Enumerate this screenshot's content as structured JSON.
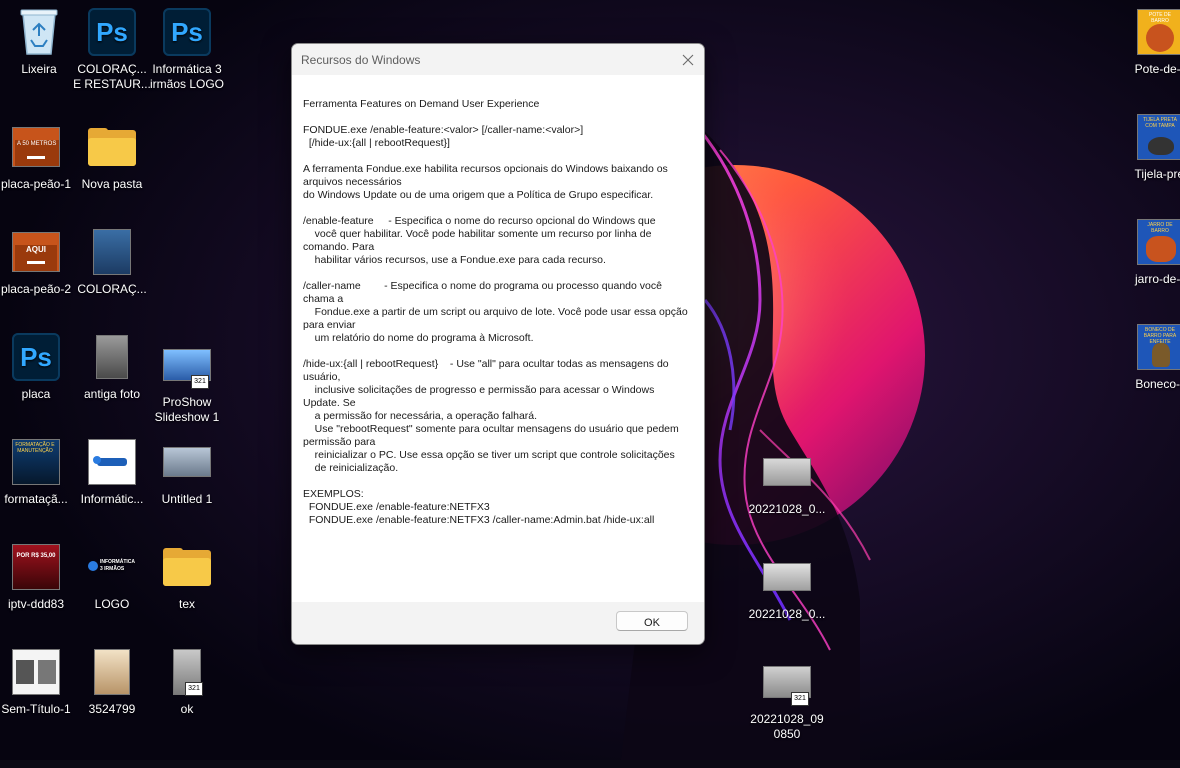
{
  "desktop": {
    "icons": [
      {
        "label": "Lixeira",
        "type": "recycle-bin"
      },
      {
        "label": "COLORAÇ... E RESTAUR...",
        "type": "photoshop"
      },
      {
        "label": "Informática 3 irmãos LOGO",
        "type": "photoshop"
      },
      {
        "label": "placa-peão-1",
        "type": "image"
      },
      {
        "label": "Nova pasta",
        "type": "folder"
      },
      {
        "label": "placa-peão-2",
        "type": "image"
      },
      {
        "label": "COLORAÇ...",
        "type": "image"
      },
      {
        "label": "placa",
        "type": "photoshop"
      },
      {
        "label": "antiga foto",
        "type": "image"
      },
      {
        "label": "ProShow Slideshow 1",
        "type": "video"
      },
      {
        "label": "formataçã...",
        "type": "image"
      },
      {
        "label": "Informátic...",
        "type": "image"
      },
      {
        "label": "Untitled 1",
        "type": "image"
      },
      {
        "label": "iptv-ddd83",
        "type": "image"
      },
      {
        "label": "LOGO",
        "type": "image"
      },
      {
        "label": "tex",
        "type": "folder"
      },
      {
        "label": "Sem-Título-1",
        "type": "image"
      },
      {
        "label": "3524799",
        "type": "image"
      },
      {
        "label": "ok",
        "type": "video"
      },
      {
        "label": "20221028_0...",
        "type": "image"
      },
      {
        "label": "20221028_0...",
        "type": "image"
      },
      {
        "label": "20221028_090850",
        "type": "video"
      },
      {
        "label": "Pote-de-b",
        "type": "image"
      },
      {
        "label": "Tijela-pret",
        "type": "image"
      },
      {
        "label": "jarro-de-b",
        "type": "image"
      },
      {
        "label": "Boneco-d",
        "type": "image"
      }
    ],
    "thumb_texts": {
      "placa1": "A 50 METROS",
      "placa2": "AQUI",
      "pote": "POTE DE BARRO",
      "tijela": "TIJELA PRETA COM TAMPA",
      "jarro": "JARRO DE BARRO",
      "boneco": "BONECO DE BARRO PARA ENFEITE",
      "iptv": "POR R$ 35,00",
      "logo": "INFORMÁTICA 3 IRMÃOS",
      "formatacao": "FORMATAÇÃO E MANUTENÇÃO",
      "video_badge": "321"
    }
  },
  "dialog": {
    "title": "Recursos do Windows",
    "close_icon": "close-icon",
    "text": "Ferramenta Features on Demand User Experience\n\nFONDUE.exe /enable-feature:<valor> [/caller-name:<valor>]\n  [/hide-ux:{all | rebootRequest}]\n\nA ferramenta Fondue.exe habilita recursos opcionais do Windows baixando os arquivos necessários\ndo Windows Update ou de uma origem que a Política de Grupo especificar.\n\n/enable-feature     - Especifica o nome do recurso opcional do Windows que\n    você quer habilitar. Você pode habilitar somente um recurso por linha de comando. Para\n    habilitar vários recursos, use a Fondue.exe para cada recurso.\n\n/caller-name        - Especifica o nome do programa ou processo quando você chama a\n    Fondue.exe a partir de um script ou arquivo de lote. Você pode usar essa opção para enviar\n    um relatório do nome do programa à Microsoft.\n\n/hide-ux:{all | rebootRequest}    - Use \"all\" para ocultar todas as mensagens do usuário,\n    inclusive solicitações de progresso e permissão para acessar o Windows Update. Se\n    a permissão for necessária, a operação falhará.\n    Use \"rebootRequest\" somente para ocultar mensagens do usuário que pedem permissão para\n    reinicializar o PC. Use essa opção se tiver um script que controle solicitações\n    de reinicialização.\n\nEXEMPLOS:\n  FONDUE.exe /enable-feature:NETFX3\n  FONDUE.exe /enable-feature:NETFX3 /caller-name:Admin.bat /hide-ux:all",
    "ok_label": "OK"
  }
}
